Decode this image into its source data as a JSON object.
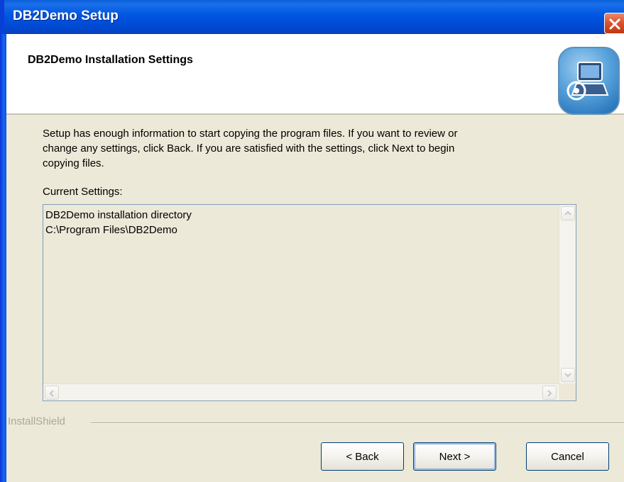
{
  "window": {
    "title": "DB2Demo Setup"
  },
  "header": {
    "title": "DB2Demo Installation Settings"
  },
  "body": {
    "description": "Setup has enough information to start copying the program files.  If you want to review or\nchange any settings, click Back.  If you are satisfied with the settings, click Next to begin\ncopying files.",
    "current_settings_label": "Current Settings:",
    "settings_lines": "DB2Demo installation directory\nC:\\Program Files\\DB2Demo"
  },
  "footer": {
    "brand": "InstallShield"
  },
  "buttons": {
    "back": "< Back",
    "next": "Next >",
    "cancel": "Cancel"
  },
  "icons": {
    "close": "close-icon",
    "logo": "setup-computer-icon",
    "scroll_up": "chevron-up-icon",
    "scroll_down": "chevron-down-icon",
    "scroll_left": "chevron-left-icon",
    "scroll_right": "chevron-right-icon"
  },
  "colors": {
    "titlebar": "#0055e3",
    "dialog_bg": "#ece9d8",
    "close": "#d9502d"
  }
}
